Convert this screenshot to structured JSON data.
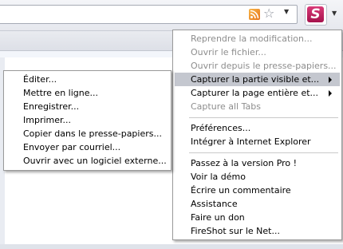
{
  "icons": {
    "rss": "rss-feed-icon",
    "star": "bookmark-star-icon",
    "fireshot": "fireshot-logo-icon",
    "dropdown": "chevron-down-icon",
    "submenu": "chevron-right-icon"
  },
  "colors": {
    "fireshot_brand": "#c21f5f",
    "highlight": "#c4c7cf",
    "disabled_text": "#8d8d8d"
  },
  "fireshot": {
    "logo_letter": "S"
  },
  "main_menu": {
    "items": [
      {
        "label": "Reprendre la modification...",
        "disabled": true
      },
      {
        "label": "Ouvrir le fichier...",
        "disabled": true
      },
      {
        "label": "Ouvrir depuis le presse-papiers...",
        "disabled": true
      },
      {
        "label": "Capturer la partie visible et...",
        "highlighted": true,
        "has_submenu": true
      },
      {
        "label": "Capturer la page entière et...",
        "has_submenu": true
      },
      {
        "label": "Capture all Tabs",
        "disabled": true
      },
      {
        "label": "Préférences..."
      },
      {
        "label": "Intégrer à Internet Explorer"
      },
      {
        "label": "Passez à la version Pro !"
      },
      {
        "label": "Voir la démo"
      },
      {
        "label": "Écrire un commentaire"
      },
      {
        "label": "Assistance"
      },
      {
        "label": "Faire un don"
      },
      {
        "label": "FireShot sur le Net..."
      }
    ]
  },
  "sub_menu": {
    "items": [
      {
        "label": "Éditer..."
      },
      {
        "label": "Mettre en ligne..."
      },
      {
        "label": "Enregistrer..."
      },
      {
        "label": "Imprimer..."
      },
      {
        "label": "Copier dans le presse-papiers..."
      },
      {
        "label": "Envoyer par courriel..."
      },
      {
        "label": "Ouvrir avec un logiciel externe..."
      }
    ]
  }
}
